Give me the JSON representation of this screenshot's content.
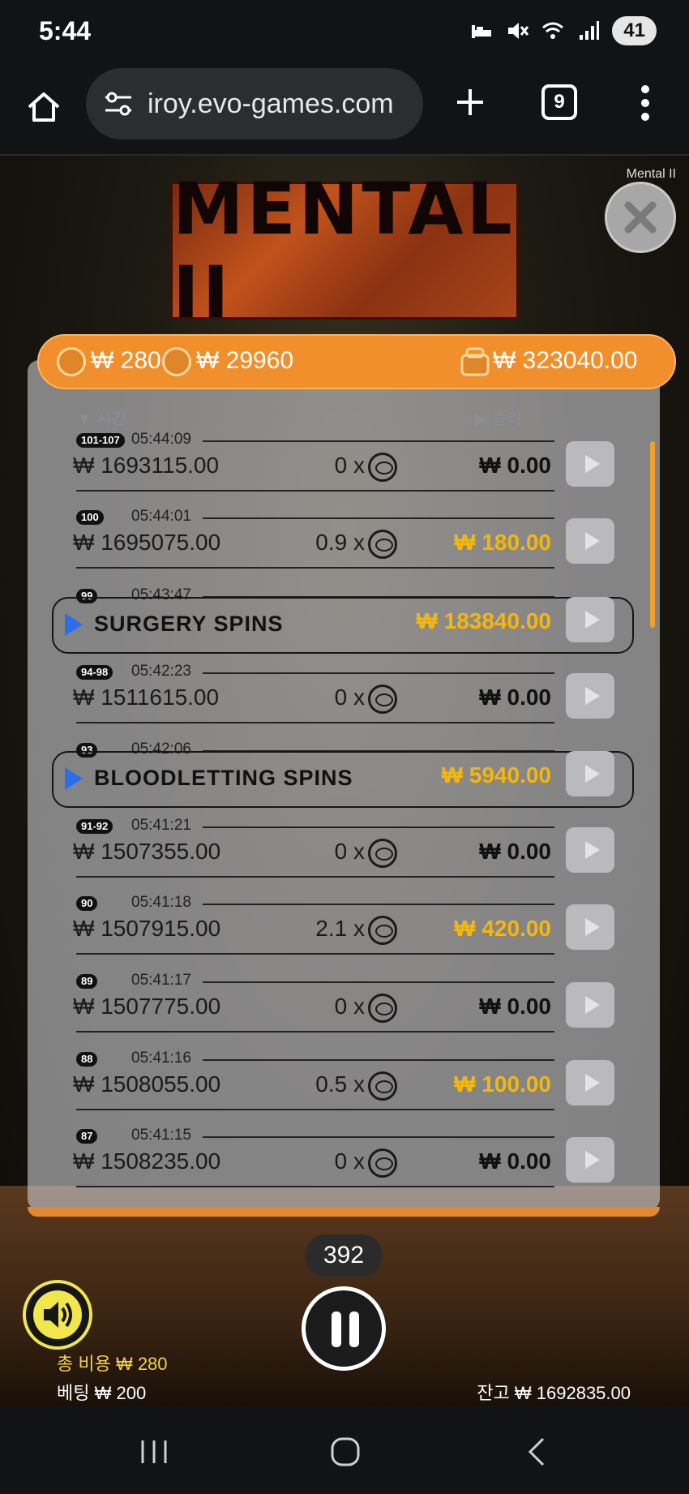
{
  "status": {
    "time": "5:44",
    "battery": "41"
  },
  "browser": {
    "url": "iroy.evo-games.com",
    "tab_count": "9"
  },
  "game": {
    "name": "Mental II",
    "logo": "MENTAL II",
    "header": {
      "cost": "₩ 280",
      "bet_total": "₩ 29960",
      "balance": "₩ 323040.00"
    },
    "columns": {
      "time": "시간",
      "win": "승리"
    },
    "rows": [
      {
        "badge": "101-107",
        "time": "05:44:09",
        "balance": "₩ 1693115.00",
        "mult": "0 x",
        "win": "₩ 0.00",
        "highlight": false
      },
      {
        "badge": "100",
        "time": "05:44:01",
        "balance": "₩ 1695075.00",
        "mult": "0.9 x",
        "win": "₩ 180.00",
        "highlight": true
      },
      {
        "badge": "99",
        "time": "05:43:47",
        "feature": "SURGERY SPINS",
        "win": "₩ 183840.00",
        "highlight": true
      },
      {
        "badge": "94-98",
        "time": "05:42:23",
        "balance": "₩ 1511615.00",
        "mult": "0 x",
        "win": "₩ 0.00",
        "highlight": false
      },
      {
        "badge": "93",
        "time": "05:42:06",
        "feature": "BLOODLETTING SPINS",
        "win": "₩ 5940.00",
        "highlight": true
      },
      {
        "badge": "91-92",
        "time": "05:41:21",
        "balance": "₩ 1507355.00",
        "mult": "0 x",
        "win": "₩ 0.00",
        "highlight": false
      },
      {
        "badge": "90",
        "time": "05:41:18",
        "balance": "₩ 1507915.00",
        "mult": "2.1 x",
        "win": "₩ 420.00",
        "highlight": true
      },
      {
        "badge": "89",
        "time": "05:41:17",
        "balance": "₩ 1507775.00",
        "mult": "0 x",
        "win": "₩ 0.00",
        "highlight": false
      },
      {
        "badge": "88",
        "time": "05:41:16",
        "balance": "₩ 1508055.00",
        "mult": "0.5 x",
        "win": "₩ 100.00",
        "highlight": true
      },
      {
        "badge": "87",
        "time": "05:41:15",
        "balance": "₩ 1508235.00",
        "mult": "0 x",
        "win": "₩ 0.00",
        "highlight": false
      }
    ],
    "hud": {
      "spins_left": "392",
      "total_cost": "총 비용 ₩ 280",
      "bet": "베팅 ₩ 200",
      "balance": "잔고 ₩ 1692835.00"
    }
  },
  "colors": {
    "accent": "#f08f2c",
    "gold": "#f4b70c",
    "feature_play": "#2b6ee8"
  }
}
